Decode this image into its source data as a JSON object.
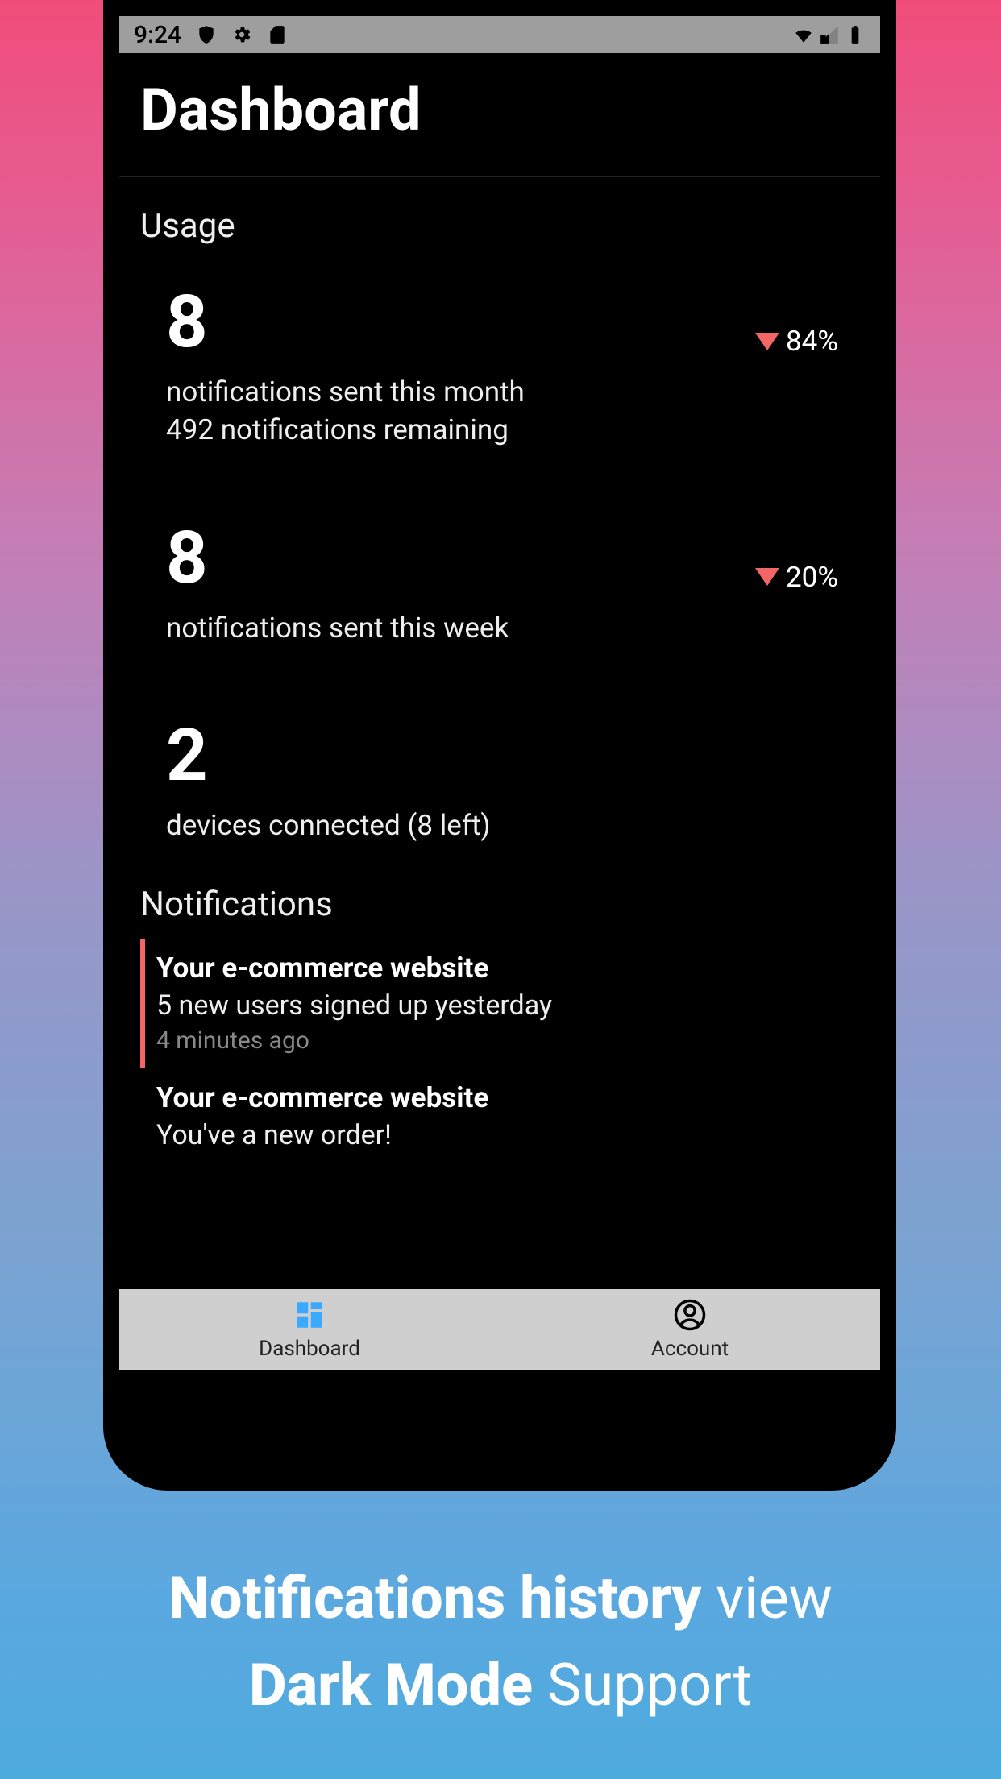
{
  "status_bar": {
    "time": "9:24"
  },
  "header": {
    "title": "Dashboard"
  },
  "usage": {
    "section_title": "Usage",
    "stats": [
      {
        "number": "8",
        "label_line1": "notifications sent this month",
        "label_line2": "492 notifications remaining",
        "trend_percent": "84%"
      },
      {
        "number": "8",
        "label_line1": "notifications sent this week",
        "trend_percent": "20%"
      },
      {
        "number": "2",
        "label_line1": "devices connected (8 left)"
      }
    ]
  },
  "notifications": {
    "section_title": "Notifications",
    "items": [
      {
        "title": "Your e-commerce website",
        "body": "5 new users signed up yesterday",
        "time": "4 minutes ago",
        "unread": true
      },
      {
        "title": "Your e-commerce website",
        "body": "You've a new order!",
        "unread": false
      }
    ]
  },
  "bottom_nav": {
    "items": [
      {
        "label": "Dashboard",
        "icon": "dashboard-icon",
        "active": true
      },
      {
        "label": "Account",
        "icon": "account-icon",
        "active": false
      }
    ]
  },
  "promo": {
    "line1_bold": "Notifications history",
    "line1_rest": " view",
    "line2_bold": "Dark Mode",
    "line2_rest": " Support"
  },
  "colors": {
    "accent_red": "#f46666",
    "nav_active": "#3ba9ff"
  }
}
